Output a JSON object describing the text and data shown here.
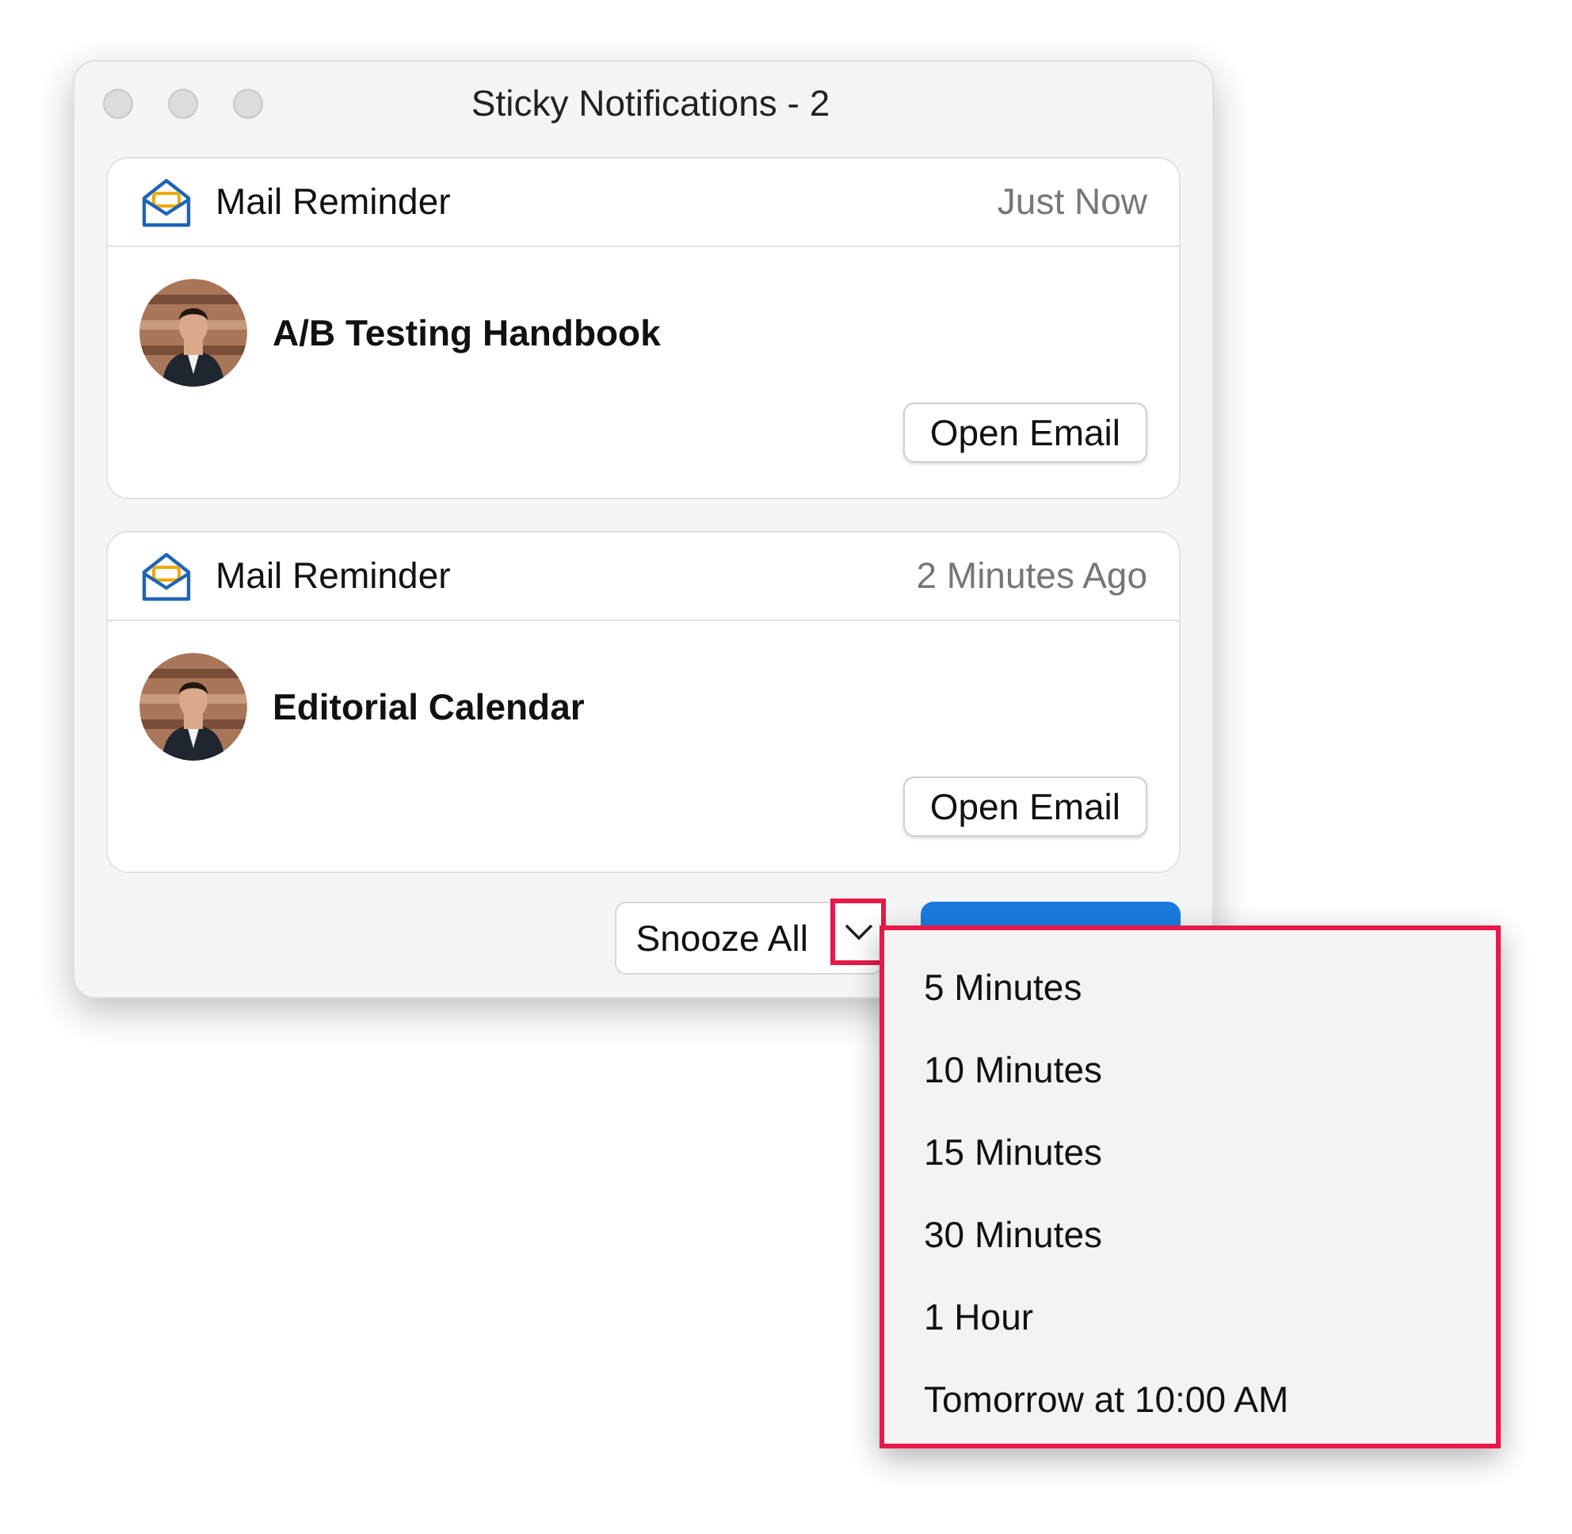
{
  "window": {
    "title": "Sticky Notifications - 2"
  },
  "notifications": [
    {
      "app": "Mail Reminder",
      "time": "Just Now",
      "subject": "A/B Testing Handbook",
      "action": "Open Email"
    },
    {
      "app": "Mail Reminder",
      "time": "2 Minutes Ago",
      "subject": "Editorial Calendar",
      "action": "Open Email"
    }
  ],
  "footer": {
    "snooze": "Snooze All",
    "menu_open": true
  },
  "snooze_menu": [
    "5 Minutes",
    "10 Minutes",
    "15 Minutes",
    "30 Minutes",
    "1 Hour",
    "Tomorrow at 10:00 AM"
  ]
}
